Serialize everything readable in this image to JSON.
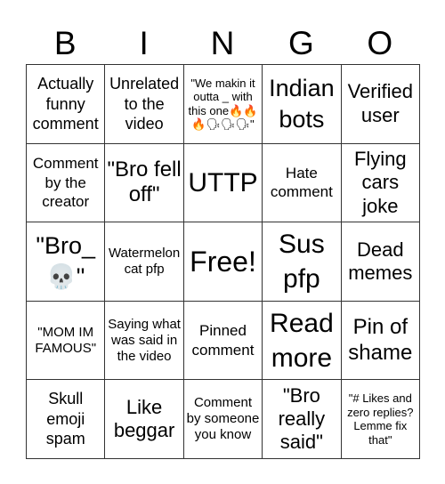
{
  "header": {
    "letters": [
      "B",
      "I",
      "N",
      "G",
      "O"
    ]
  },
  "board": {
    "cells": [
      "Actually funny comment",
      "Unrelated to the video",
      "\"We makin it outta _ with this one🔥🔥🔥🗣🗣🗣\"",
      "Indian bots",
      "Verified user",
      "Comment by the creator",
      "\"Bro fell off\"",
      "UTTP",
      "Hate comment",
      "Flying cars joke",
      "\"Bro_ 💀\"",
      "Watermelon cat pfp",
      "Free!",
      "Sus pfp",
      "Dead memes",
      "\"MOM IM FAMOUS\"",
      "Saying what was said in the video",
      "Pinned comment",
      "Read more",
      "Pin of shame",
      "Skull emoji spam",
      "Like beggar",
      "Comment by someone you know",
      "\"Bro really said\"",
      "\"# Likes and zero replies? Lemme fix that\""
    ],
    "free_space_index": 12
  }
}
